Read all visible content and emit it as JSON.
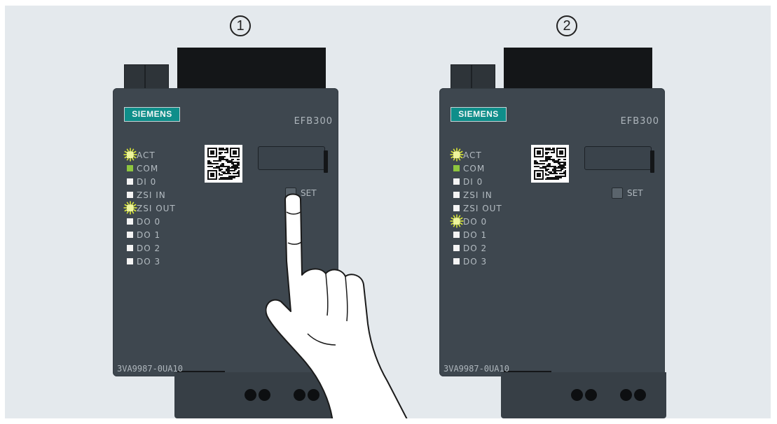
{
  "steps": [
    "1",
    "2"
  ],
  "devices": [
    {
      "brand": "SIEMENS",
      "model": "EFB300",
      "set_label": "SET",
      "article_number": "3VA9987-0UA10",
      "leds": [
        {
          "label": "ACT",
          "state": "flashing"
        },
        {
          "label": "COM",
          "state": "green"
        },
        {
          "label": "DI 0",
          "state": "off"
        },
        {
          "label": "ZSI IN",
          "state": "off"
        },
        {
          "label": "ZSI OUT",
          "state": "flashing"
        },
        {
          "label": "DO 0",
          "state": "off"
        },
        {
          "label": "DO 1",
          "state": "off"
        },
        {
          "label": "DO 2",
          "state": "off"
        },
        {
          "label": "DO 3",
          "state": "off"
        }
      ],
      "set_pressed": true
    },
    {
      "brand": "SIEMENS",
      "model": "EFB300",
      "set_label": "SET",
      "article_number": "3VA9987-0UA10",
      "leds": [
        {
          "label": "ACT",
          "state": "flashing"
        },
        {
          "label": "COM",
          "state": "green"
        },
        {
          "label": "DI 0",
          "state": "off"
        },
        {
          "label": "ZSI IN",
          "state": "off"
        },
        {
          "label": "ZSI OUT",
          "state": "off"
        },
        {
          "label": "DO 0",
          "state": "flashing"
        },
        {
          "label": "DO 1",
          "state": "off"
        },
        {
          "label": "DO 2",
          "state": "off"
        },
        {
          "label": "DO 3",
          "state": "off"
        }
      ],
      "set_pressed": false
    }
  ],
  "colors": {
    "background": "#e4e9ed",
    "housing": "#3e474f",
    "logo": "#0f8e8a",
    "led_green": "#8ec63f",
    "led_off": "#f4f4f4",
    "flash_glow": "#d9e637"
  },
  "icons": [
    "qr-code-icon",
    "pressing-finger-hand-icon",
    "led-flashing-icon"
  ]
}
